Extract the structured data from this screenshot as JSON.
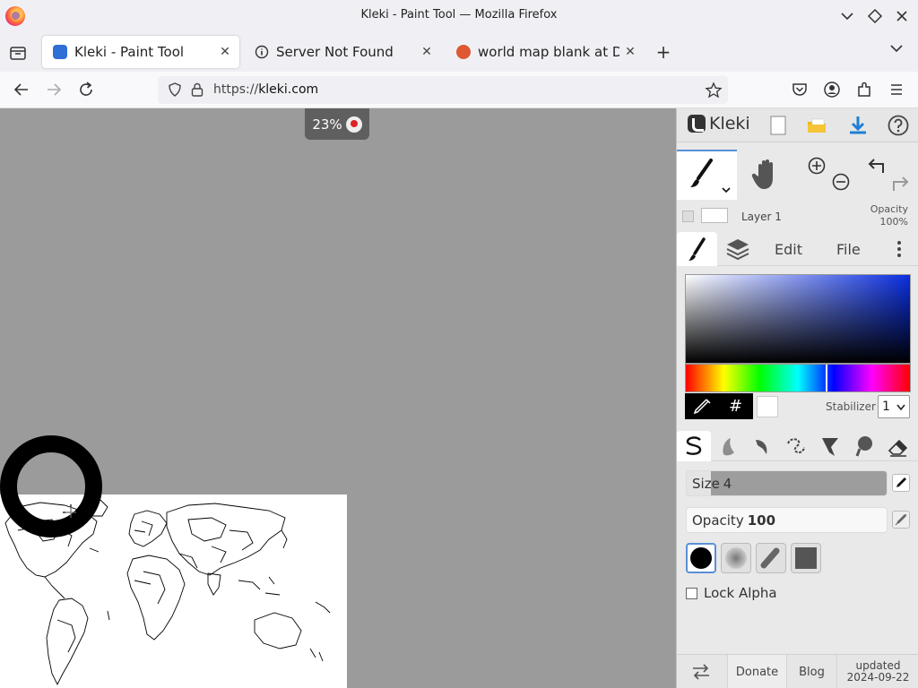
{
  "window": {
    "title": "Kleki - Paint Tool — Mozilla Firefox"
  },
  "tabs": [
    {
      "label": "Kleki - Paint Tool",
      "active": true,
      "favicon_color": "#2f6fd6"
    },
    {
      "label": "Server Not Found",
      "active": false,
      "favicon": "info-icon"
    },
    {
      "label": "world map blank at Duck",
      "active": false,
      "favicon_color": "#de5833"
    }
  ],
  "navbar": {
    "url_scheme": "https://",
    "url_host": "kleki.com"
  },
  "canvas": {
    "zoom": "23%"
  },
  "kleki": {
    "logo_text": "Kleki",
    "layer": {
      "name": "Layer 1",
      "opacity_label": "Opacity",
      "opacity_value": "100%"
    },
    "panel_tabs": {
      "edit": "Edit",
      "file": "File"
    },
    "color": {
      "hex_symbol": "#",
      "primary": "#000000",
      "secondary": "#ffffff"
    },
    "stabilizer": {
      "label": "Stabilizer",
      "value": "1"
    },
    "brush": {
      "size_label": "Size",
      "size_value": "4",
      "size_fraction": 0.12,
      "opacity_label": "Opacity",
      "opacity_value": "100",
      "opacity_fraction": 1.0
    },
    "lock_alpha": {
      "label": "Lock Alpha",
      "checked": false
    },
    "bottom": {
      "donate": "Donate",
      "blog": "Blog",
      "updated_label": "updated",
      "updated_date": "2024-09-22"
    }
  },
  "colors": {
    "accent": "#5a8fd6",
    "download": "#1e7fd6",
    "folder": "#f0b81c"
  }
}
